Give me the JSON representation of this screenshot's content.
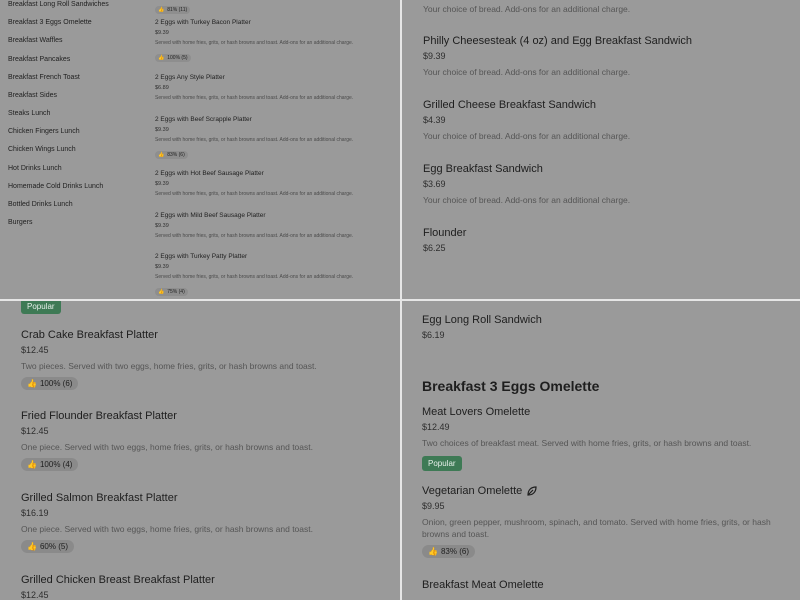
{
  "sidebar": {
    "categories": [
      "Breakfast Long Roll Sandwiches",
      "Breakfast 3 Eggs Omelette",
      "Breakfast Waffles",
      "Breakfast Pancakes",
      "Breakfast French Toast",
      "Breakfast Sides",
      "Steaks Lunch",
      "Chicken Fingers Lunch",
      "Chicken Wings Lunch",
      "Hot Drinks Lunch",
      "Homemade Cold Drinks Lunch",
      "Bottled Drinks Lunch",
      "Burgers"
    ]
  },
  "top_left": {
    "partial_rating": "81% (11)",
    "items": [
      {
        "name": "2 Eggs with Turkey Bacon Platter",
        "price": "$9.39",
        "desc": "Served with home fries, grits, or hash browns and toast. Add-ons for an additional charge.",
        "rating": "100% (5)"
      },
      {
        "name": "2 Eggs Any Style Platter",
        "price": "$6.89",
        "desc": "Served with home fries, grits, or hash browns and toast. Add-ons for an additional charge.",
        "rating": ""
      },
      {
        "name": "2 Eggs with Beef Scrapple Platter",
        "price": "$9.39",
        "desc": "Served with home fries, grits, or hash browns and toast. Add-ons for an additional charge.",
        "rating": "83% (6)"
      },
      {
        "name": "2 Eggs with Hot Beef Sausage Platter",
        "price": "$9.39",
        "desc": "Served with home fries, grits, or hash browns and toast. Add-ons for an additional charge.",
        "rating": ""
      },
      {
        "name": "2 Eggs with Mild Beef Sausage Platter",
        "price": "$9.39",
        "desc": "Served with home fries, grits, or hash browns and toast. Add-ons for an additional charge.",
        "rating": ""
      },
      {
        "name": "2 Eggs with Turkey Patty Platter",
        "price": "$9.39",
        "desc": "Served with home fries, grits, or hash browns and toast. Add-ons for an additional charge.",
        "rating": "75% (4)"
      }
    ]
  },
  "top_right": {
    "partial_desc": "Your choice of bread. Add-ons for an additional charge.",
    "items": [
      {
        "name": "Philly Cheesesteak (4 oz) and Egg Breakfast Sandwich",
        "price": "$9.39",
        "desc": "Your choice of bread. Add-ons for an additional charge."
      },
      {
        "name": "Grilled Cheese Breakfast Sandwich",
        "price": "$4.39",
        "desc": "Your choice of bread. Add-ons for an additional charge."
      },
      {
        "name": "Egg Breakfast Sandwich",
        "price": "$3.69",
        "desc": "Your choice of bread. Add-ons for an additional charge."
      },
      {
        "name": "Flounder",
        "price": "$6.25",
        "desc": ""
      }
    ]
  },
  "bottom_left": {
    "partial_badge": "Popular",
    "items": [
      {
        "name": "Crab Cake Breakfast Platter",
        "price": "$12.45",
        "desc": "Two pieces. Served with two eggs, home fries, grits, or hash browns and toast.",
        "rating": "100% (6)"
      },
      {
        "name": "Fried Flounder Breakfast Platter",
        "price": "$12.45",
        "desc": "One piece. Served with two eggs, home fries, grits, or hash browns and toast.",
        "rating": "100% (4)"
      },
      {
        "name": "Grilled Salmon Breakfast Platter",
        "price": "$16.19",
        "desc": "One piece. Served with two eggs, home fries, grits, or hash browns and toast.",
        "rating": "60% (5)"
      },
      {
        "name": "Grilled Chicken Breast Breakfast Platter",
        "price": "$12.45",
        "desc": "",
        "rating": ""
      }
    ]
  },
  "bottom_right": {
    "item_long_roll": {
      "name": "Egg Long Roll Sandwich",
      "price": "$6.19"
    },
    "section_title": "Breakfast 3 Eggs Omelette",
    "items": [
      {
        "name": "Meat Lovers Omelette",
        "price": "$12.49",
        "desc": "Two choices of breakfast meat. Served with home fries, grits, or hash browns and toast.",
        "badge": "Popular",
        "rating": ""
      },
      {
        "name": "Vegetarian Omelette",
        "price": "$9.95",
        "desc": "Onion, green pepper, mushroom, spinach, and tomato. Served with home fries, grits, or hash browns and toast.",
        "badge": "",
        "rating": "83% (6)"
      },
      {
        "name": "Breakfast Meat Omelette",
        "price": "",
        "desc": "",
        "badge": "",
        "rating": ""
      }
    ]
  },
  "icons": {
    "rating": "thumbs-up-icon",
    "vegetarian": "leaf-icon"
  },
  "colors": {
    "popular_badge": "#3e7a55",
    "divider": "#e6e6e6"
  }
}
